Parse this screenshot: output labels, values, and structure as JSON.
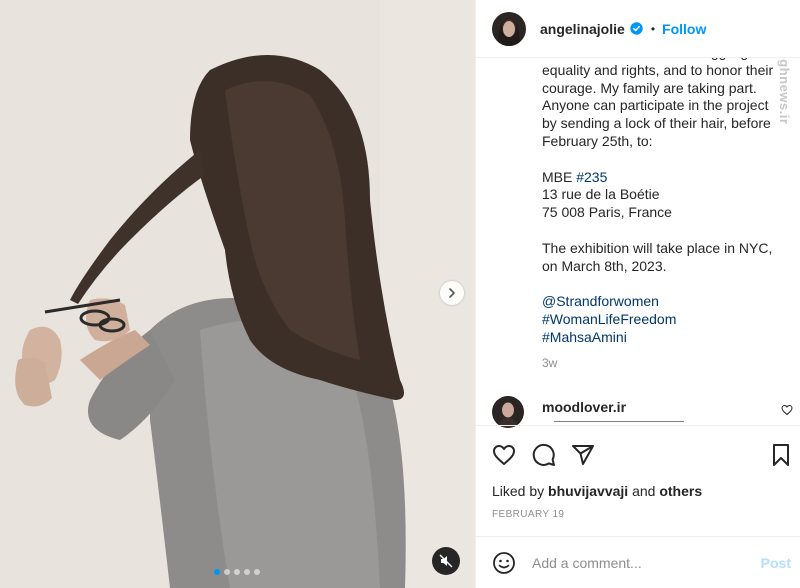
{
  "post": {
    "author": {
      "username": "angelinajolie",
      "verified": true,
      "bullet": "•",
      "follow_label": "Follow"
    },
    "watermark": "mashreghnews.ir",
    "caption": {
      "intro": "women in Iran who are struggling for equality and rights, and to honor their courage. My family are taking part. Anyone can participate in the project by sending a lock of their hair, before February 25th, to:",
      "address_label": "MBE",
      "address_tag": "#235",
      "address_line2": "13 rue de la Boétie",
      "address_line3": "75 008 Paris, France",
      "exhibition": "The exhibition will take place in NYC, on March 8th, 2023.",
      "hashtags": [
        "@Strandforwomen",
        "#WomanLifeFreedom",
        "#MahsaAmini"
      ],
      "time_ago": "3w"
    },
    "comment": {
      "username": "moodlover.ir"
    },
    "likes": {
      "prefix": "Liked by",
      "user": "bhuvijavvaji",
      "conjunction": "and",
      "others": "others"
    },
    "date": "FEBRUARY 19",
    "add_comment": {
      "placeholder": "Add a comment...",
      "post_label": "Post"
    }
  },
  "media": {
    "carousel_count": 5,
    "active_index": 0,
    "has_next": true,
    "muted": true
  },
  "colors": {
    "link": "#0095f6",
    "hashtag": "#00376b",
    "text": "#262626",
    "muted": "#8e8e8e",
    "post_disabled": "#b2dffc"
  },
  "icons": [
    "verified-badge-icon",
    "chevron-right-icon",
    "muted-speaker-icon",
    "heart-icon",
    "comment-icon",
    "share-icon",
    "bookmark-icon",
    "emoji-icon"
  ]
}
